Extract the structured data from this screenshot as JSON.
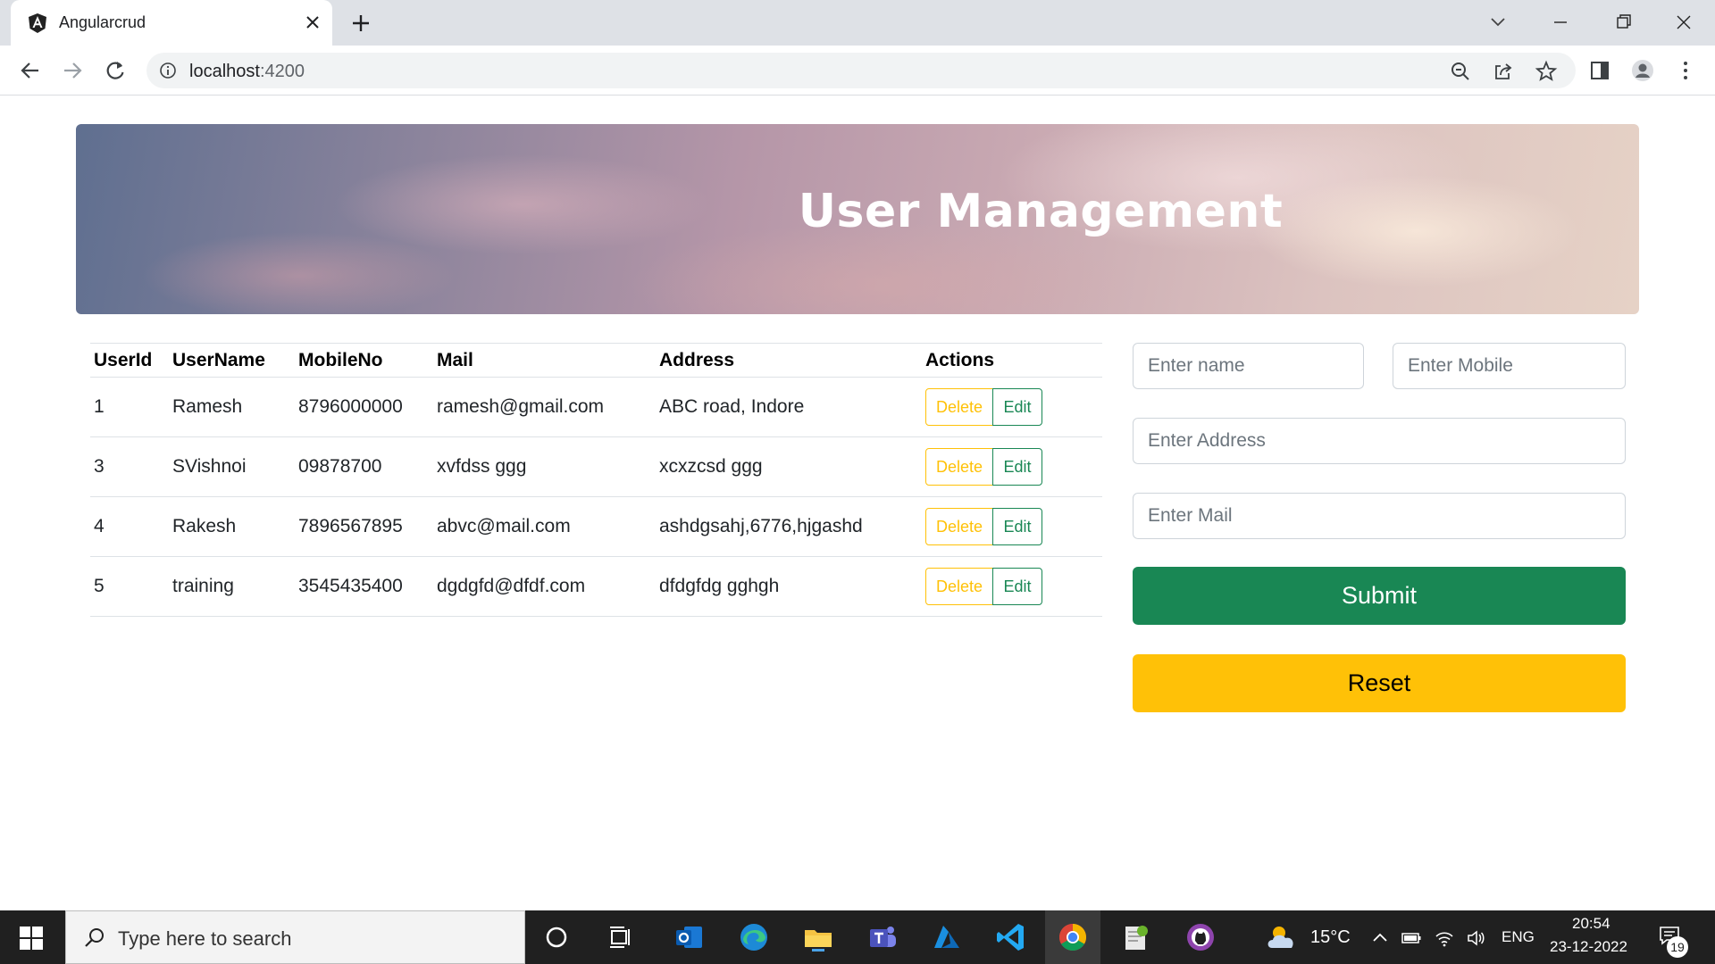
{
  "browser": {
    "tab_title": "Angularcrud",
    "url_host": "localhost",
    "url_port": ":4200"
  },
  "header": {
    "title": "User Management"
  },
  "table": {
    "columns": [
      "UserId",
      "UserName",
      "MobileNo",
      "Mail",
      "Address",
      "Actions"
    ],
    "rows": [
      [
        "1",
        "Ramesh",
        "8796000000",
        "ramesh@gmail.com",
        "ABC road, Indore"
      ],
      [
        "3",
        "SVishnoi",
        "09878700",
        "xvfdss ggg",
        "xcxzcsd ggg"
      ],
      [
        "4",
        "Rakesh",
        "7896567895",
        "abvc@mail.com",
        "ashdgsahj,6776,hjgashd"
      ],
      [
        "5",
        "training",
        "3545435400",
        "dgdgfd@dfdf.com",
        "dfdgfdg gghgh"
      ]
    ],
    "delete_label": "Delete",
    "edit_label": "Edit"
  },
  "form": {
    "name_placeholder": "Enter name",
    "mobile_placeholder": "Enter Mobile",
    "address_placeholder": "Enter Address",
    "mail_placeholder": "Enter Mail",
    "submit_label": "Submit",
    "reset_label": "Reset"
  },
  "taskbar": {
    "search_placeholder": "Type here to search",
    "weather": "15°C",
    "language": "ENG",
    "time": "20:54",
    "date": "23-12-2022",
    "notification_count": "19"
  },
  "colors": {
    "success": "#198754",
    "warning": "#ffc107",
    "taskbar": "#202020"
  }
}
